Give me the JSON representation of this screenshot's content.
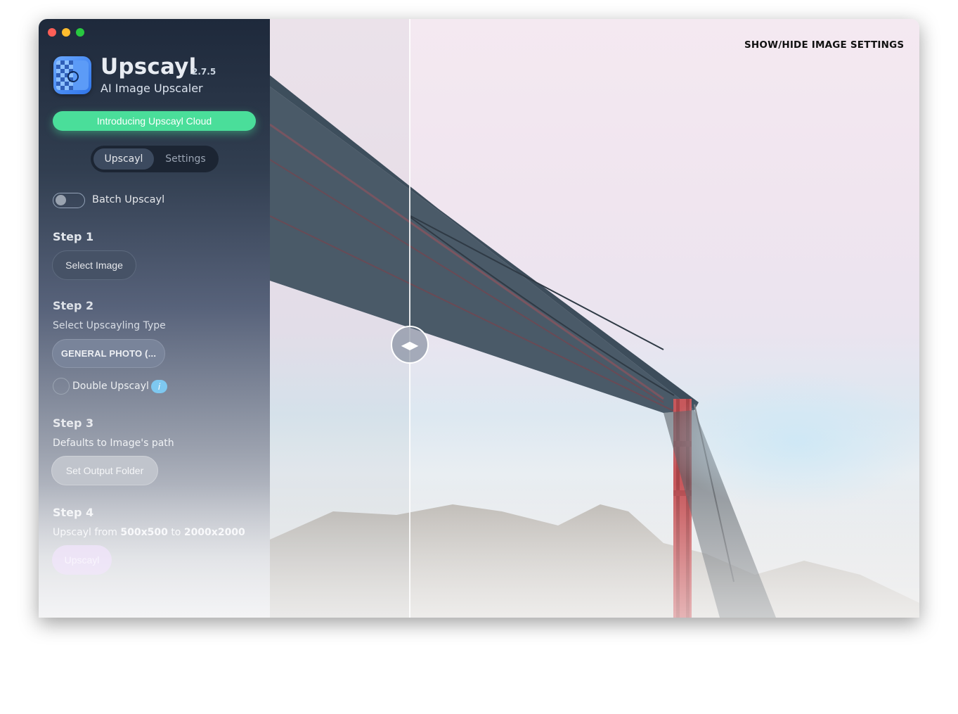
{
  "app": {
    "name": "Upscayl",
    "version": "2.7.5",
    "subtitle": "AI Image Upscaler"
  },
  "cloud_button": "Introducing Upscayl Cloud",
  "tabs": [
    {
      "label": "Upscayl",
      "active": true
    },
    {
      "label": "Settings",
      "active": false
    }
  ],
  "batch": {
    "label": "Batch Upscayl",
    "enabled": false
  },
  "step1": {
    "title": "Step 1",
    "button": "Select Image"
  },
  "step2": {
    "title": "Step 2",
    "description": "Select Upscayling Type",
    "selected_type": "GENERAL PHOTO (...",
    "double_label": "Double Upscayl",
    "double_checked": false,
    "info_glyph": "i"
  },
  "step3": {
    "title": "Step 3",
    "description": "Defaults to Image's path",
    "button": "Set Output Folder"
  },
  "step4": {
    "title": "Step 4",
    "prefix": "Upscayl from",
    "from_res": "500x500",
    "mid": "to",
    "to_res": "2000x2000",
    "button": "Upscayl"
  },
  "image_panel": {
    "settings_toggle": "SHOW/HIDE IMAGE SETTINGS",
    "compare_handle_icon": "left-right-arrows-icon",
    "compare_split": 0.215
  },
  "colors": {
    "accent_green": "#4ade9a",
    "upscayl_button": "#e6d9f3",
    "sidebar_top": "#1e293b"
  }
}
